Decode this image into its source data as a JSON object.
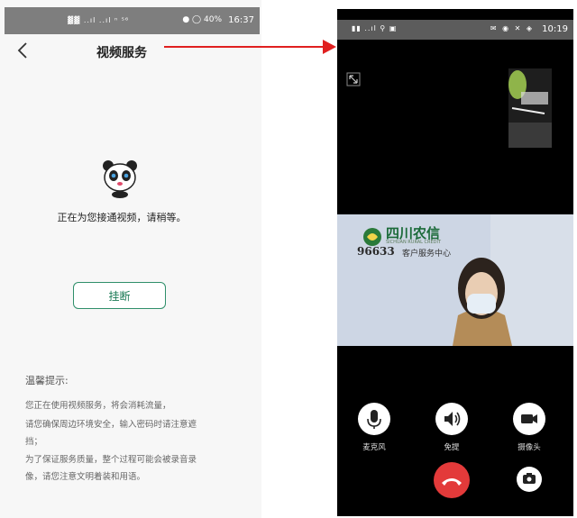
{
  "left": {
    "status_bar": {
      "signal": "▓▓ ..ıl ..ıl ⁿ ⁵⁶",
      "battery": "● ◯ 40%",
      "time": "16:37"
    },
    "title": "视频服务",
    "connecting_text": "正在为您接通视频，请稍等。",
    "hangup_label": "挂断",
    "tips": {
      "title": "温馨提示:",
      "lines": [
        "您正在使用视频服务，将会消耗流量，",
        "请您确保周边环境安全，输入密码时请注意遮",
        "挡；",
        "为了保证服务质量，整个过程可能会被录音录",
        "像，请您注意文明着装和用语。"
      ]
    }
  },
  "right": {
    "status_bar": {
      "time": "10:19"
    },
    "bank": {
      "name": "四川农信",
      "english": "SICHUAN RURAL CREDIT",
      "hotline": "96633",
      "service_center": "客户服务中心"
    },
    "controls": {
      "mute_label": "麦克风",
      "speaker_label": "免提",
      "camera_label": "摄像头"
    }
  },
  "colors": {
    "accent": "#2f8f6a",
    "end_call": "#e33a3a",
    "arrow": "#e02020"
  }
}
